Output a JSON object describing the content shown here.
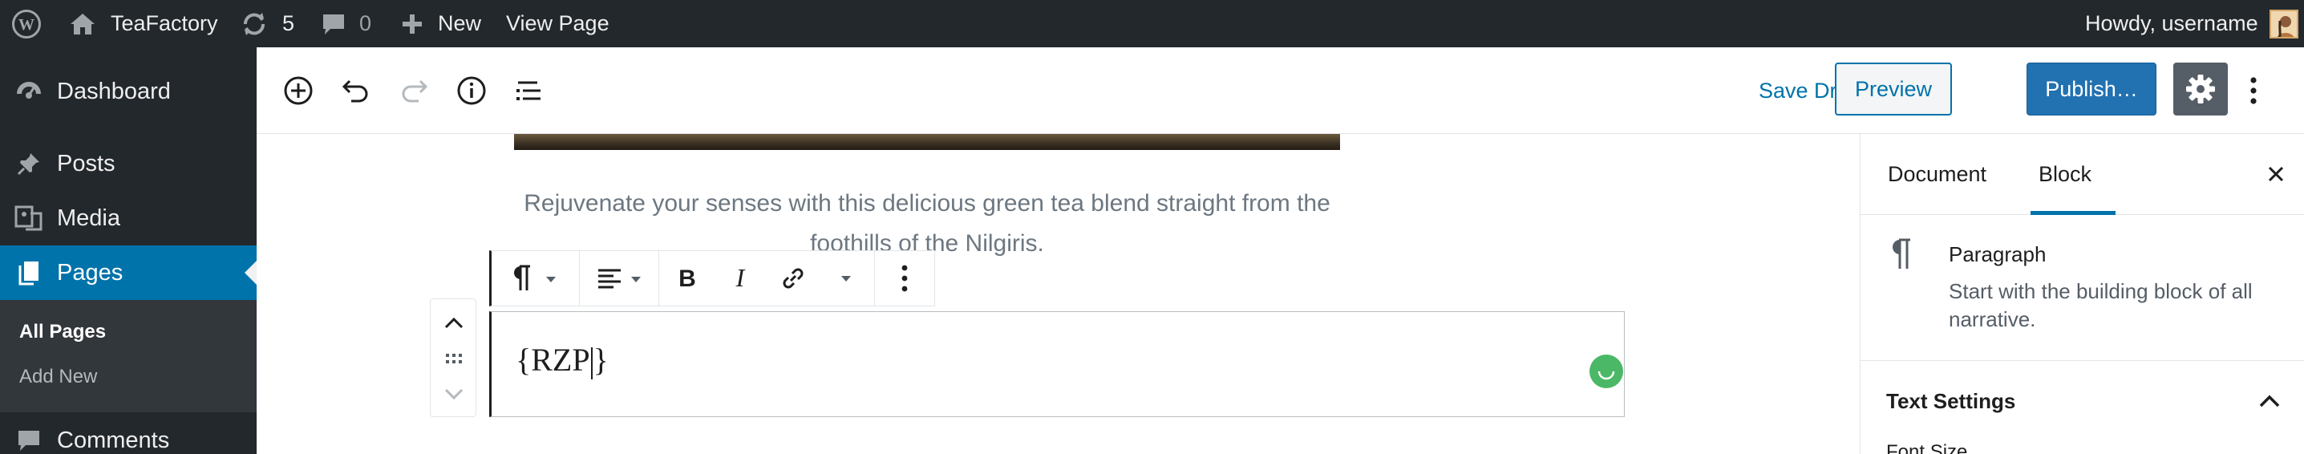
{
  "admin_bar": {
    "site_name": "TeaFactory",
    "updates_count": "5",
    "comments_count": "0",
    "new_label": "New",
    "view_page_label": "View Page",
    "greeting": "Howdy, username",
    "icons": [
      "wordpress-logo-icon",
      "home-icon",
      "updates-icon",
      "comments-icon",
      "plus-icon",
      "avatar"
    ]
  },
  "admin_menu": {
    "items": [
      {
        "label": "Dashboard",
        "icon": "dashboard-icon"
      },
      {
        "label": "Posts",
        "icon": "pin-icon"
      },
      {
        "label": "Media",
        "icon": "media-icon"
      },
      {
        "label": "Pages",
        "icon": "pages-icon",
        "current": true
      },
      {
        "label": "Comments",
        "icon": "comments-icon"
      }
    ],
    "submenu": [
      "All Pages",
      "Add New"
    ],
    "active_submenu": "All Pages",
    "accent_color": "#0073aa"
  },
  "editor_header": {
    "tools": [
      "add-block-icon",
      "undo-icon",
      "redo-icon",
      "info-icon",
      "block-navigation-icon"
    ],
    "save_draft_label": "Save Draft",
    "preview_label": "Preview",
    "publish_label": "Publish…",
    "settings_icon": "gear-icon",
    "more_icon": "more-vertical-icon"
  },
  "content": {
    "caption": "Rejuvenate your senses with this delicious green tea blend straight from the foothills of the Nilgiris.",
    "block_text_before_caret": "{RZP",
    "block_text_after_caret": "}",
    "status_color": "#4ab866"
  },
  "block_toolbar": {
    "icons": [
      "paragraph-icon",
      "align-left-icon",
      "bold-icon",
      "italic-icon",
      "link-icon",
      "more-rich-text-icon",
      "more-options-icon"
    ]
  },
  "sidebar": {
    "tabs": [
      "Document",
      "Block"
    ],
    "active_tab": "Block",
    "block_card": {
      "title": "Paragraph",
      "description": "Start with the building block of all narrative."
    },
    "panel_title": "Text Settings",
    "panel_peek": "Font Size"
  }
}
